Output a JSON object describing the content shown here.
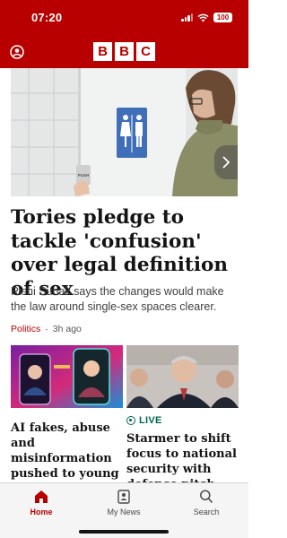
{
  "status_bar": {
    "time": "07:20",
    "battery": "100"
  },
  "header": {
    "logo": [
      "B",
      "B",
      "C"
    ]
  },
  "lead_story": {
    "headline": "Tories pledge to tackle 'confusion' over legal definition of sex",
    "summary": "Rishi Sunak says the changes would make the law around single-sex spaces clearer.",
    "category": "Politics",
    "separator": "·",
    "time_ago": "3h ago",
    "push_sign": "PUSH"
  },
  "cards": [
    {
      "title": "AI fakes, abuse and misinformation pushed to young"
    },
    {
      "live_label": "LIVE",
      "title": "Starmer to shift focus to national security with defence pitch"
    }
  ],
  "tab_bar": {
    "items": [
      {
        "label": "Home",
        "icon": "home-icon",
        "active": true
      },
      {
        "label": "My News",
        "icon": "my-news-icon",
        "active": false
      },
      {
        "label": "Search",
        "icon": "search-icon",
        "active": false
      }
    ]
  },
  "colors": {
    "brand": "#b80000",
    "live": "#006652"
  }
}
